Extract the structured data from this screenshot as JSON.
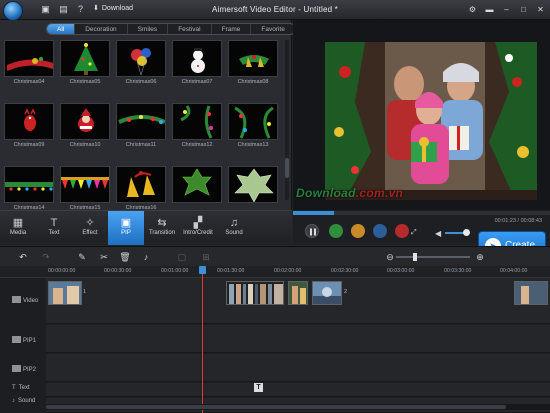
{
  "titlebar": {
    "download_label": "Download",
    "title": "Aimersoft Video Editor - Untitled *"
  },
  "library": {
    "categories": [
      "All",
      "Decoration",
      "Smiles",
      "Festival",
      "Frame",
      "Favorite"
    ],
    "active_category": "All",
    "items": [
      {
        "label": "Christmas04"
      },
      {
        "label": "Christmas05"
      },
      {
        "label": "Christmas06"
      },
      {
        "label": "Christmas07"
      },
      {
        "label": "Christmas08"
      },
      {
        "label": "Christmas09"
      },
      {
        "label": "Christmas10"
      },
      {
        "label": "Christmas11"
      },
      {
        "label": "Christmas12"
      },
      {
        "label": "Christmas13"
      },
      {
        "label": "Christmas14"
      },
      {
        "label": "Christmas15"
      },
      {
        "label": "Christmas16"
      },
      {
        "label": "",
        "leaf": true
      },
      {
        "label": ""
      }
    ]
  },
  "modules": [
    {
      "label": "Media",
      "icon": "film-icon"
    },
    {
      "label": "Text",
      "icon": "text-icon"
    },
    {
      "label": "Effect",
      "icon": "wand-icon"
    },
    {
      "label": "PIP",
      "icon": "pip-icon",
      "active": true
    },
    {
      "label": "Transition",
      "icon": "transition-icon"
    },
    {
      "label": "Intro/Credit",
      "icon": "clapper-icon"
    },
    {
      "label": "Sound",
      "icon": "headphones-icon"
    }
  ],
  "playback": {
    "timecode": "00:01:23 / 00:08:43",
    "progress": 0.158
  },
  "create_label": "Create",
  "watermark": {
    "main": "Download",
    "suffix": ".com.vn"
  },
  "timeline": {
    "ticks": [
      "00:00:00:00",
      "00:00:30:00",
      "00:01:00:00",
      "00:01:30:00",
      "00:02:00:00",
      "00:02:30:00",
      "00:03:00:00",
      "00:03:30:00",
      "00:04:00:00"
    ],
    "tracks": [
      "Video",
      "PIP1",
      "PIP2",
      "Text",
      "Sound"
    ],
    "clip_numbers": [
      "1",
      "2"
    ],
    "text_marker": "T"
  },
  "colors": {
    "accent": "#2a7fd6",
    "playhead": "#e23a3a",
    "background": "#222428"
  }
}
